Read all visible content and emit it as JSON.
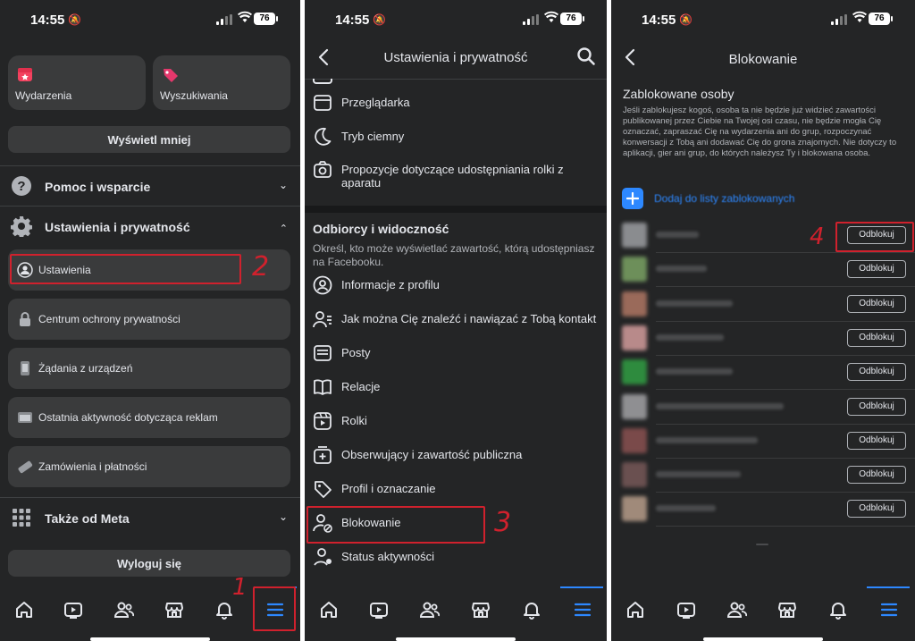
{
  "status": {
    "time": "14:55",
    "battery": "76"
  },
  "panel1": {
    "tiles": [
      {
        "label": "Wydarzenia",
        "icon": "calendar-icon"
      },
      {
        "label": "Wyszukiwania",
        "icon": "price-tag-icon"
      }
    ],
    "show_less": "Wyświetl mniej",
    "help": "Pomoc i wsparcie",
    "settings_privacy": "Ustawienia i prywatność",
    "sub_items": [
      {
        "label": "Ustawienia",
        "icon": "user-circle-icon"
      },
      {
        "label": "Centrum ochrony prywatności",
        "icon": "lock-icon"
      },
      {
        "label": "Żądania z urządzeń",
        "icon": "phone-device-icon"
      },
      {
        "label": "Ostatnia aktywność dotycząca reklam",
        "icon": "ad-activity-icon"
      },
      {
        "label": "Zamówienia i płatności",
        "icon": "card-payment-icon"
      }
    ],
    "also_meta": "Także od Meta",
    "logout": "Wyloguj się",
    "annotations": {
      "step1": "1",
      "step2": "2"
    }
  },
  "panel2": {
    "title": "Ustawienia i prywatność",
    "items_top": [
      {
        "label": "Przeglądarka",
        "icon": "browser-icon"
      },
      {
        "label": "Tryb ciemny",
        "icon": "moon-icon"
      },
      {
        "label": "Propozycje dotyczące udostępniania rolki z aparatu",
        "icon": "camera-icon"
      }
    ],
    "section_title": "Odbiorcy i widoczność",
    "section_desc": "Określ, kto może wyświetlać zawartość, którą udostępniasz na Facebooku.",
    "items": [
      {
        "label": "Informacje z profilu",
        "icon": "profile-info-icon"
      },
      {
        "label": "Jak można Cię znaleźć i nawiązać z Tobą kontakt",
        "icon": "find-contact-icon"
      },
      {
        "label": "Posty",
        "icon": "posts-icon"
      },
      {
        "label": "Relacje",
        "icon": "stories-book-icon"
      },
      {
        "label": "Rolki",
        "icon": "reels-icon"
      },
      {
        "label": "Obserwujący i zawartość publiczna",
        "icon": "followers-icon"
      },
      {
        "label": "Profil i oznaczanie",
        "icon": "tag-icon"
      },
      {
        "label": "Blokowanie",
        "icon": "block-user-icon"
      },
      {
        "label": "Status aktywności",
        "icon": "activity-status-icon"
      }
    ],
    "annotations": {
      "step3": "3"
    }
  },
  "panel3": {
    "title": "Blokowanie",
    "section_title": "Zablokowane osoby",
    "section_desc": "Jeśli zablokujesz kogoś, osoba ta nie będzie już widzieć zawartości publikowanej przez Ciebie na Twojej osi czasu, nie będzie mogła Cię oznaczać, zapraszać Cię na wydarzenia ani do grup, rozpoczynać konwersacji z Tobą ani dodawać Cię do grona znajomych. Nie dotyczy to aplikacji, gier ani grup, do których należysz Ty i blokowana osoba.",
    "add_label": "Dodaj do listy zablokowanych",
    "unblock_label": "Odblokuj",
    "blocked_count": 9,
    "avatar_colors": [
      "#8a8c8f",
      "#6d8f5a",
      "#9a6a5a",
      "#b88a8a",
      "#2e8b3e",
      "#8f8f92",
      "#7a4a4a",
      "#6a5050",
      "#a08a7a"
    ],
    "name_widths": [
      0.25,
      0.3,
      0.45,
      0.4,
      0.45,
      0.75,
      0.6,
      0.5,
      0.35
    ],
    "annotations": {
      "step4": "4"
    }
  },
  "tabs": [
    {
      "name": "home-icon"
    },
    {
      "name": "video-icon"
    },
    {
      "name": "friends-icon"
    },
    {
      "name": "marketplace-icon"
    },
    {
      "name": "notifications-bell-icon"
    },
    {
      "name": "menu-icon"
    }
  ],
  "colors": {
    "accent": "#2d88ff",
    "annotation": "#d0212d",
    "panel_bg": "#242526",
    "card_bg": "#3a3b3c"
  }
}
